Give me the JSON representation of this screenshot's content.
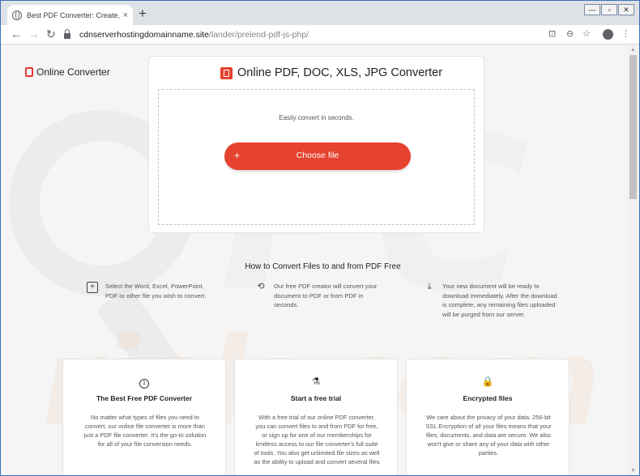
{
  "browser": {
    "tab_title": "Best PDF Converter: Create, Conve",
    "tab_close": "×",
    "new_tab": "+",
    "win_minimize": "—",
    "win_maximize": "▫",
    "win_close": "✕",
    "url_host": "cdnserverhostingdomainname.site",
    "url_path": "/lander/prelend-pdf-js-php/",
    "back": "←",
    "forward": "→",
    "reload": "↻",
    "translate_icon": "⊡",
    "zoom_icon": "⊖",
    "star_icon": "☆",
    "menu_icon": "⋮"
  },
  "header": {
    "brand_name": "Online Converter"
  },
  "upload": {
    "title": "Online PDF, DOC, XLS, JPG Converter",
    "subtitle": "Easily convert in seconds.",
    "button_plus": "+",
    "button_label": "Choose file"
  },
  "howto": {
    "title": "How to Convert Files to and from PDF Free",
    "steps": [
      {
        "icon": "plus-box-icon",
        "glyph": "+",
        "text": "Select the Word, Excel, PowerPoint, PDF or other file you wish to convert."
      },
      {
        "icon": "sync-arrows-icon",
        "glyph": "⟲",
        "text": "Our free PDF creator will convert your document to PDF or from PDF in seconds."
      },
      {
        "icon": "download-icon",
        "glyph": "⤓",
        "text": "Your new document will be ready to download immediately. After the download is complete, any remaining files uploaded will be purged from our server."
      }
    ]
  },
  "features": [
    {
      "icon": "number-one-icon",
      "glyph": "1",
      "title": "The Best Free PDF Converter",
      "body": "No matter what types of files you need to convert, our online file converter is more than just a PDF file converter. It's the go-to solution for all of your file conversion needs."
    },
    {
      "icon": "flask-icon",
      "glyph": "⚗",
      "title": "Start a free trial",
      "body": "With a free trial of our online PDF converter, you can convert files to and from PDF for free, or sign up for one of our memberships for limitless access to our file converter's full suite of tools. You also get unlimited file sizes as well as the ability to upload and convert several files"
    },
    {
      "icon": "lock-icon",
      "glyph": "🔒",
      "title": "Encrypted files",
      "body": "We care about the privacy of your data. 256-bit SSL Encryption of all your files means that your files, documents, and data are secure. We also won't give or share any of your data with other parties."
    }
  ],
  "watermark": {
    "text": "risk.com",
    "letters": "PC"
  },
  "colors": {
    "accent": "#e5432f",
    "window_border": "#3c6fb8"
  }
}
